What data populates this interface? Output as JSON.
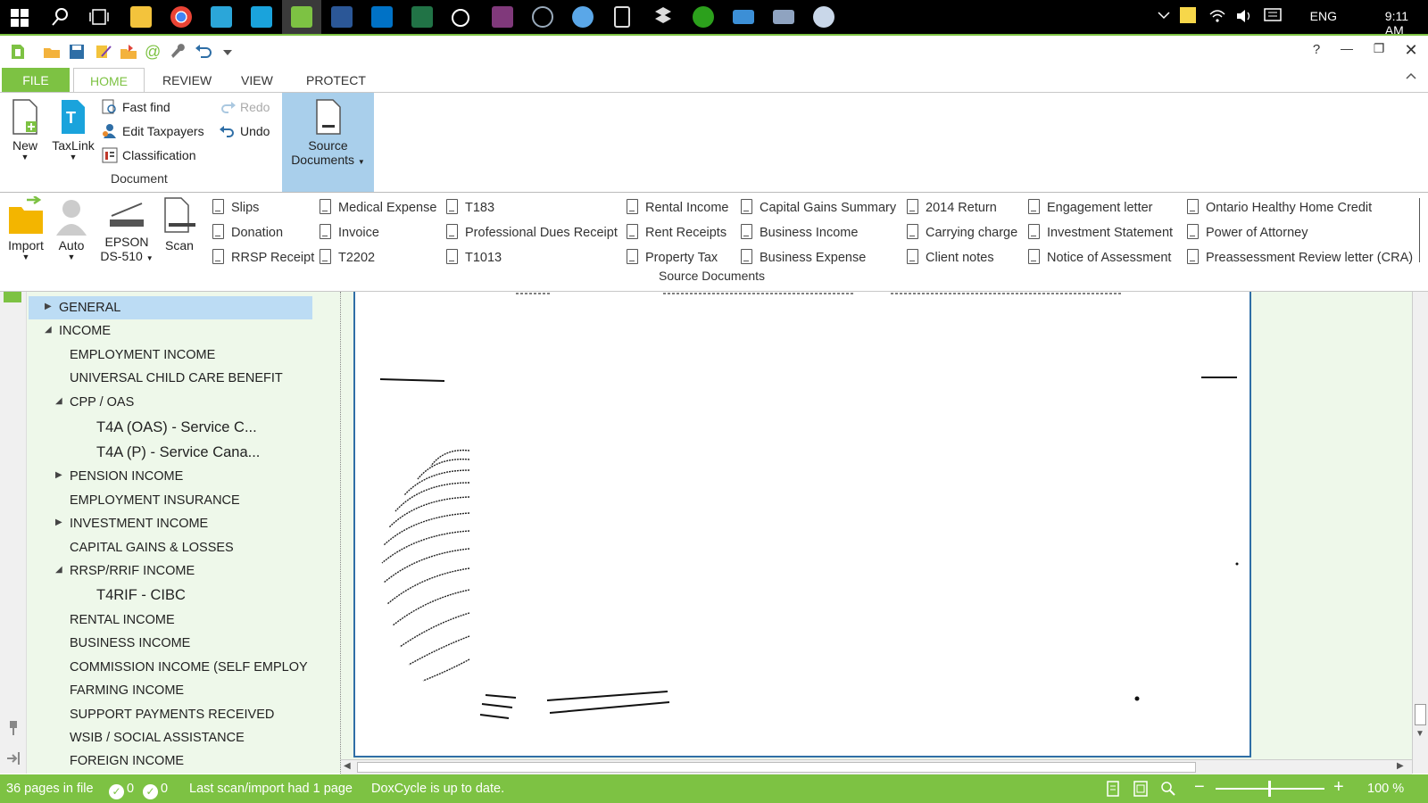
{
  "taskbar": {
    "language": "ENG",
    "time": "9:11 AM"
  },
  "window": {
    "help": "?",
    "minimize": "—",
    "restore": "❐",
    "close": "✕"
  },
  "tabs": {
    "file": "FILE",
    "home": "HOME",
    "review": "REVIEW",
    "view": "VIEW",
    "protect": "PROTECT"
  },
  "ribbon": {
    "new_label": "New",
    "taxlink_label": "TaxLink",
    "fast_find": "Fast find",
    "edit_taxpayers": "Edit Taxpayers",
    "classification": "Classification",
    "redo": "Redo",
    "undo": "Undo",
    "source_documents_line1": "Source",
    "source_documents_line2": "Documents",
    "document_group": "Document"
  },
  "source_panel": {
    "import_label": "Import",
    "auto_label": "Auto",
    "scanner_line1": "EPSON",
    "scanner_line2": "DS-510",
    "scan_label": "Scan",
    "group_label": "Source Documents",
    "col1": [
      "Slips",
      "Donation",
      "RRSP Receipt"
    ],
    "col2": [
      "Medical Expense",
      "Invoice",
      "T2202"
    ],
    "col3": [
      "T183",
      "Professional Dues Receipt",
      "T1013"
    ],
    "col4": [
      "Rental Income",
      "Rent Receipts",
      "Property Tax"
    ],
    "col5": [
      "Capital Gains Summary",
      "Business Income",
      "Business Expense"
    ],
    "col6": [
      "2014 Return",
      "Carrying charge",
      "Client notes"
    ],
    "col7": [
      "Engagement letter",
      "Investment Statement",
      "Notice of Assessment"
    ],
    "col8": [
      "Ontario Healthy Home Credit",
      "Power of Attorney",
      "Preassessment Review letter (CRA)"
    ]
  },
  "tree": {
    "general": "GENERAL",
    "income": "INCOME",
    "employment_income": "EMPLOYMENT INCOME",
    "uccb": "UNIVERSAL CHILD CARE BENEFIT",
    "cpp_oas": "CPP / OAS",
    "t4a_oas": "T4A (OAS)  -  Service C...",
    "t4a_p": "T4A (P)  -  Service Cana...",
    "pension_income": "PENSION INCOME",
    "employment_insurance": "EMPLOYMENT INSURANCE",
    "investment_income": "INVESTMENT INCOME",
    "capital_gains": "CAPITAL GAINS & LOSSES",
    "rrsp_rrif": "RRSP/RRIF INCOME",
    "t4rif": "T4RIF  -  CIBC",
    "rental_income": "RENTAL INCOME",
    "business_income": "BUSINESS INCOME",
    "commission_income": "COMMISSION INCOME (SELF EMPLOY",
    "farming_income": "FARMING INCOME",
    "support_payments": "SUPPORT PAYMENTS RECEIVED",
    "wsib": "WSIB / SOCIAL ASSISTANCE",
    "foreign_income": "FOREIGN INCOME"
  },
  "status": {
    "pages_in_file": "36 pages in file",
    "count_a": "0",
    "count_b": "0",
    "last_scan": "Last scan/import had 1 page",
    "doxcycle": "DoxCycle is up to date.",
    "zoom": "100 %"
  },
  "colors": {
    "accent_green": "#7dc243",
    "selection_blue": "#a9cfeb",
    "tree_bg": "#eef8ea"
  }
}
